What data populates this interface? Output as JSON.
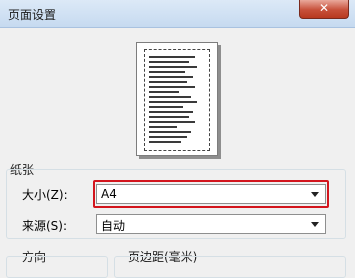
{
  "window": {
    "title": "页面设置",
    "close_glyph": "✕"
  },
  "paper": {
    "section_title": "纸张",
    "size_label": "大小(Z):",
    "size_value": "A4",
    "source_label": "来源(S):",
    "source_value": "自动"
  },
  "orientation": {
    "section_title": "方向"
  },
  "margins": {
    "section_title": "页边距(毫米)"
  },
  "colors": {
    "highlight": "#d3151d",
    "close": "#c7503a"
  }
}
